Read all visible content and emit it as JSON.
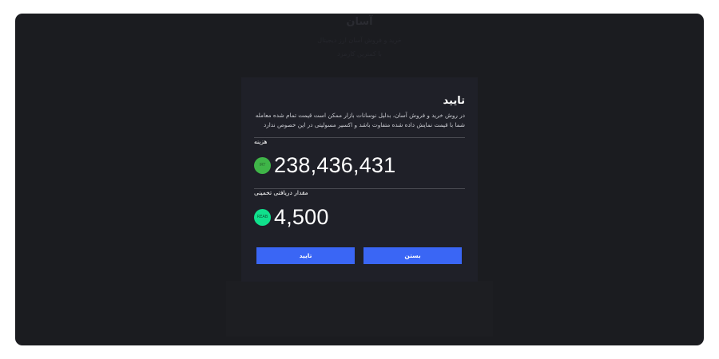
{
  "background": {
    "title": "آسان",
    "subtitle_lines": [
      "خرید و فروش آسان ارز دیجیتال",
      "با کمترین کارمزد"
    ]
  },
  "modal": {
    "title": "تایید",
    "description": "در روش خرید و فروش آسان، بدلیل نوسانات بازار ممکن است قیمت تمام شده معامله شما با قیمت نمایش داده شده متفاوت باشد و اکسیر مسولیتی در این خصوص ندارد",
    "cost": {
      "label": "هزینه",
      "currency": "IRT",
      "value": "238,436,431",
      "coin_color": "#3fb548"
    },
    "estimate": {
      "label": "مقدار دریافتی تخمینی",
      "currency": "REAB",
      "value": "4,500",
      "coin_color": "#10e08c"
    },
    "buttons": {
      "confirm_label": "تایید",
      "close_label": "بستن"
    },
    "colors": {
      "button": "#3a66f5",
      "modal_bg": "#1f2028"
    }
  }
}
